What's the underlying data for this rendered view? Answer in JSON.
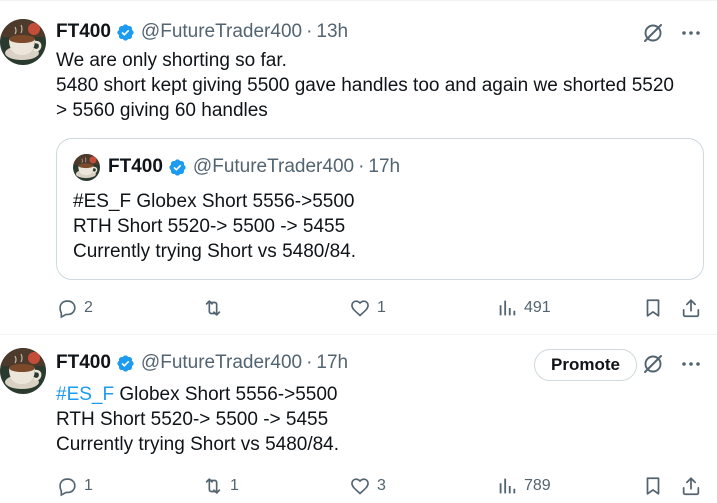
{
  "colors": {
    "text": "#0f1419",
    "secondary": "#536471",
    "link": "#1d9bf0",
    "verified": "#1d9bf0",
    "border": "#cfd9de"
  },
  "tweets": [
    {
      "name": "FT400",
      "handle": "@FutureTrader400",
      "separator": "·",
      "time": "13h",
      "lines": [
        "We are only shorting so far.",
        "5480 short kept giving 5500 gave handles too and again we shorted 5520",
        "> 5560 giving 60 handles"
      ],
      "quote": {
        "name": "FT400",
        "handle": "@FutureTrader400",
        "separator": "·",
        "time": "17h",
        "lines": [
          "#ES_F Globex Short 5556->5500",
          "RTH Short 5520-> 5500 -> 5455",
          "Currently trying Short vs 5480/84."
        ]
      },
      "actions": {
        "replies": "2",
        "reposts": "",
        "likes": "1",
        "views": "491"
      },
      "icons": [
        "grok-icon",
        "more-icon",
        "reply-icon",
        "repost-icon",
        "like-icon",
        "views-icon",
        "bookmark-icon",
        "share-icon"
      ]
    },
    {
      "name": "FT400",
      "handle": "@FutureTrader400",
      "separator": "·",
      "time": "17h",
      "promote_label": "Promote",
      "hashtag": "#ES_F",
      "line1_rest": " Globex Short 5556->5500",
      "lines": [
        "RTH Short 5520-> 5500 -> 5455",
        "Currently trying Short vs 5480/84."
      ],
      "actions": {
        "replies": "1",
        "reposts": "1",
        "likes": "3",
        "views": "789"
      },
      "icons": [
        "grok-icon",
        "more-icon",
        "reply-icon",
        "repost-icon",
        "like-icon",
        "views-icon",
        "bookmark-icon",
        "share-icon"
      ]
    }
  ]
}
